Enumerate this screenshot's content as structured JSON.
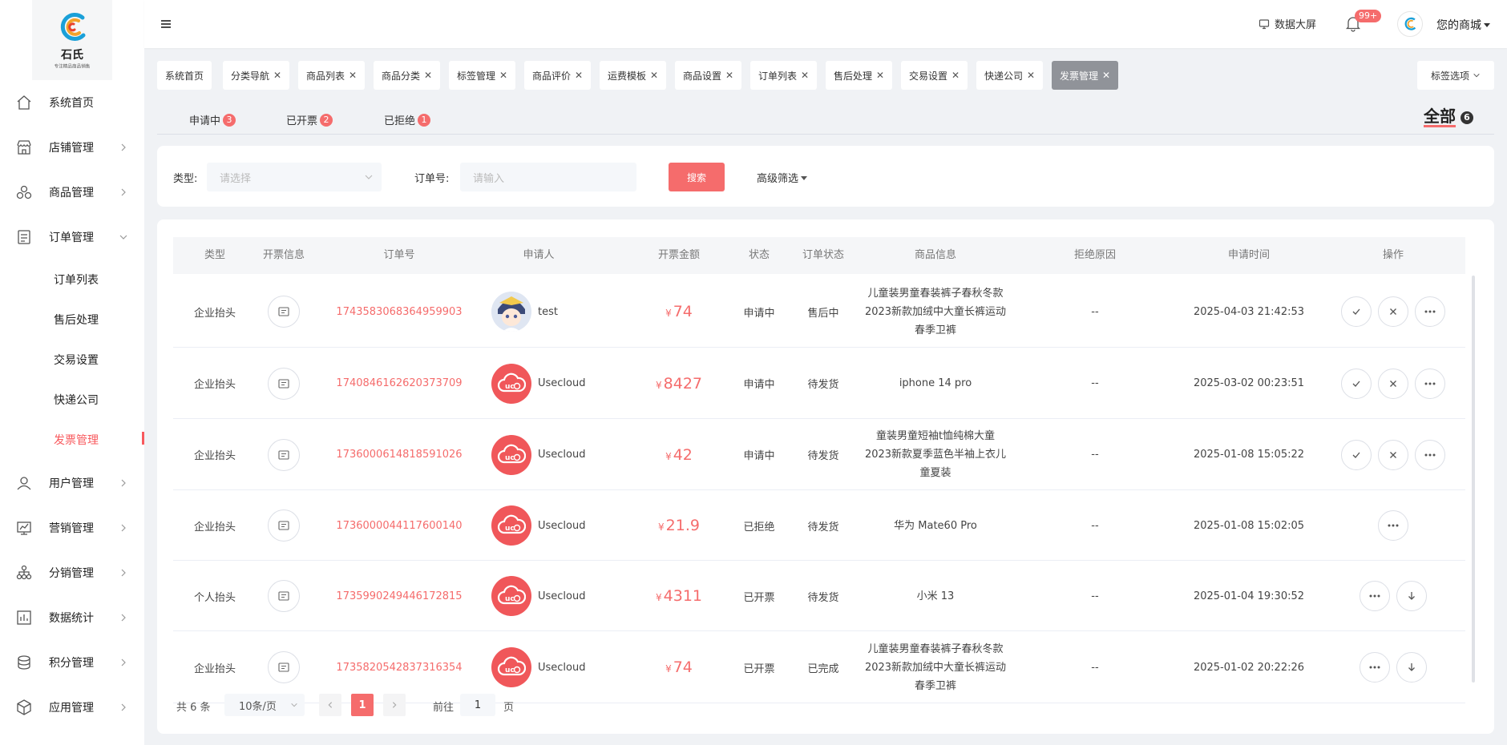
{
  "brand": {
    "name": "石氏",
    "tagline": "专注精品商品销售"
  },
  "sidebar": {
    "items": [
      {
        "label": "系统首页",
        "icon": "home-icon"
      },
      {
        "label": "店铺管理",
        "icon": "store-icon"
      },
      {
        "label": "商品管理",
        "icon": "goods-icon"
      },
      {
        "label": "订单管理",
        "icon": "order-icon"
      },
      {
        "label": "用户管理",
        "icon": "user-icon"
      },
      {
        "label": "营销管理",
        "icon": "marketing-icon"
      },
      {
        "label": "分销管理",
        "icon": "distribution-icon"
      },
      {
        "label": "数据统计",
        "icon": "chart-icon"
      },
      {
        "label": "积分管理",
        "icon": "points-icon"
      },
      {
        "label": "应用管理",
        "icon": "app-icon"
      }
    ],
    "order_sub": [
      "订单列表",
      "售后处理",
      "交易设置",
      "快递公司",
      "发票管理"
    ],
    "active_sub": "发票管理"
  },
  "header": {
    "screen": "数据大屏",
    "notif_badge": "99+",
    "user": "您的商城"
  },
  "tags": [
    "系统首页",
    "分类导航",
    "商品列表",
    "商品分类",
    "标签管理",
    "商品评价",
    "运费模板",
    "商品设置",
    "订单列表",
    "售后处理",
    "交易设置",
    "快递公司",
    "发票管理"
  ],
  "tag_active": "发票管理",
  "tag_options": "标签选项",
  "status_tabs": [
    {
      "label": "申请中",
      "count": "3"
    },
    {
      "label": "已开票",
      "count": "2"
    },
    {
      "label": "已拒绝",
      "count": "1"
    }
  ],
  "tab_all": {
    "label": "全部",
    "count": "6"
  },
  "filter": {
    "type_label": "类型:",
    "type_placeholder": "请选择",
    "order_label": "订单号:",
    "order_placeholder": "请输入",
    "search_btn": "搜索",
    "advanced": "高级筛选"
  },
  "table": {
    "columns": [
      "类型",
      "开票信息",
      "订单号",
      "申请人",
      "开票金额",
      "状态",
      "订单状态",
      "商品信息",
      "拒绝原因",
      "申请时间",
      "操作"
    ],
    "currency": "¥",
    "rows": [
      {
        "type": "企业抬头",
        "order_no": "1743583068364959903",
        "applicant": "test",
        "avatar": "anime",
        "amount": "74",
        "status": "申请中",
        "order_status": "售后中",
        "goods": "儿童装男童春装裤子春秋冬款2023新款加绒中大童长裤运动春季卫裤",
        "reject": "--",
        "time": "2025-04-03 21:42:53",
        "ops": [
          "approve",
          "reject",
          "more"
        ]
      },
      {
        "type": "企业抬头",
        "order_no": "1740846162620373709",
        "applicant": "Usecloud",
        "avatar": "ucm",
        "amount": "8427",
        "status": "申请中",
        "order_status": "待发货",
        "goods": "iphone 14 pro",
        "reject": "--",
        "time": "2025-03-02 00:23:51",
        "ops": [
          "approve",
          "reject",
          "more"
        ]
      },
      {
        "type": "企业抬头",
        "order_no": "1736000614818591026",
        "applicant": "Usecloud",
        "avatar": "ucm",
        "amount": "42",
        "status": "申请中",
        "order_status": "待发货",
        "goods": "童装男童短袖t恤纯棉大童2023新款夏季蓝色半袖上衣儿童夏装",
        "reject": "--",
        "time": "2025-01-08 15:05:22",
        "ops": [
          "approve",
          "reject",
          "more"
        ]
      },
      {
        "type": "企业抬头",
        "order_no": "1736000044117600140",
        "applicant": "Usecloud",
        "avatar": "ucm",
        "amount": "21.9",
        "status": "已拒绝",
        "order_status": "待发货",
        "goods": "华为 Mate60 Pro",
        "reject": "--",
        "time": "2025-01-08 15:02:05",
        "ops": [
          "more"
        ]
      },
      {
        "type": "个人抬头",
        "order_no": "1735990249446172815",
        "applicant": "Usecloud",
        "avatar": "ucm",
        "amount": "4311",
        "status": "已开票",
        "order_status": "待发货",
        "goods": "小米 13",
        "reject": "--",
        "time": "2025-01-04 19:30:52",
        "ops": [
          "more",
          "download"
        ]
      },
      {
        "type": "企业抬头",
        "order_no": "1735820542837316354",
        "applicant": "Usecloud",
        "avatar": "ucm",
        "amount": "74",
        "status": "已开票",
        "order_status": "已完成",
        "goods": "儿童装男童春装裤子春秋冬款2023新款加绒中大童长裤运动春季卫裤",
        "reject": "--",
        "time": "2025-01-02 20:22:26",
        "ops": [
          "more",
          "download"
        ]
      }
    ]
  },
  "pagination": {
    "total": "共 6 条",
    "page_size": "10条/页",
    "current": "1",
    "goto": "前往",
    "goto_value": "1",
    "unit": "页"
  },
  "colors": {
    "accent": "#f56c6c",
    "active_tag": "#909399"
  }
}
